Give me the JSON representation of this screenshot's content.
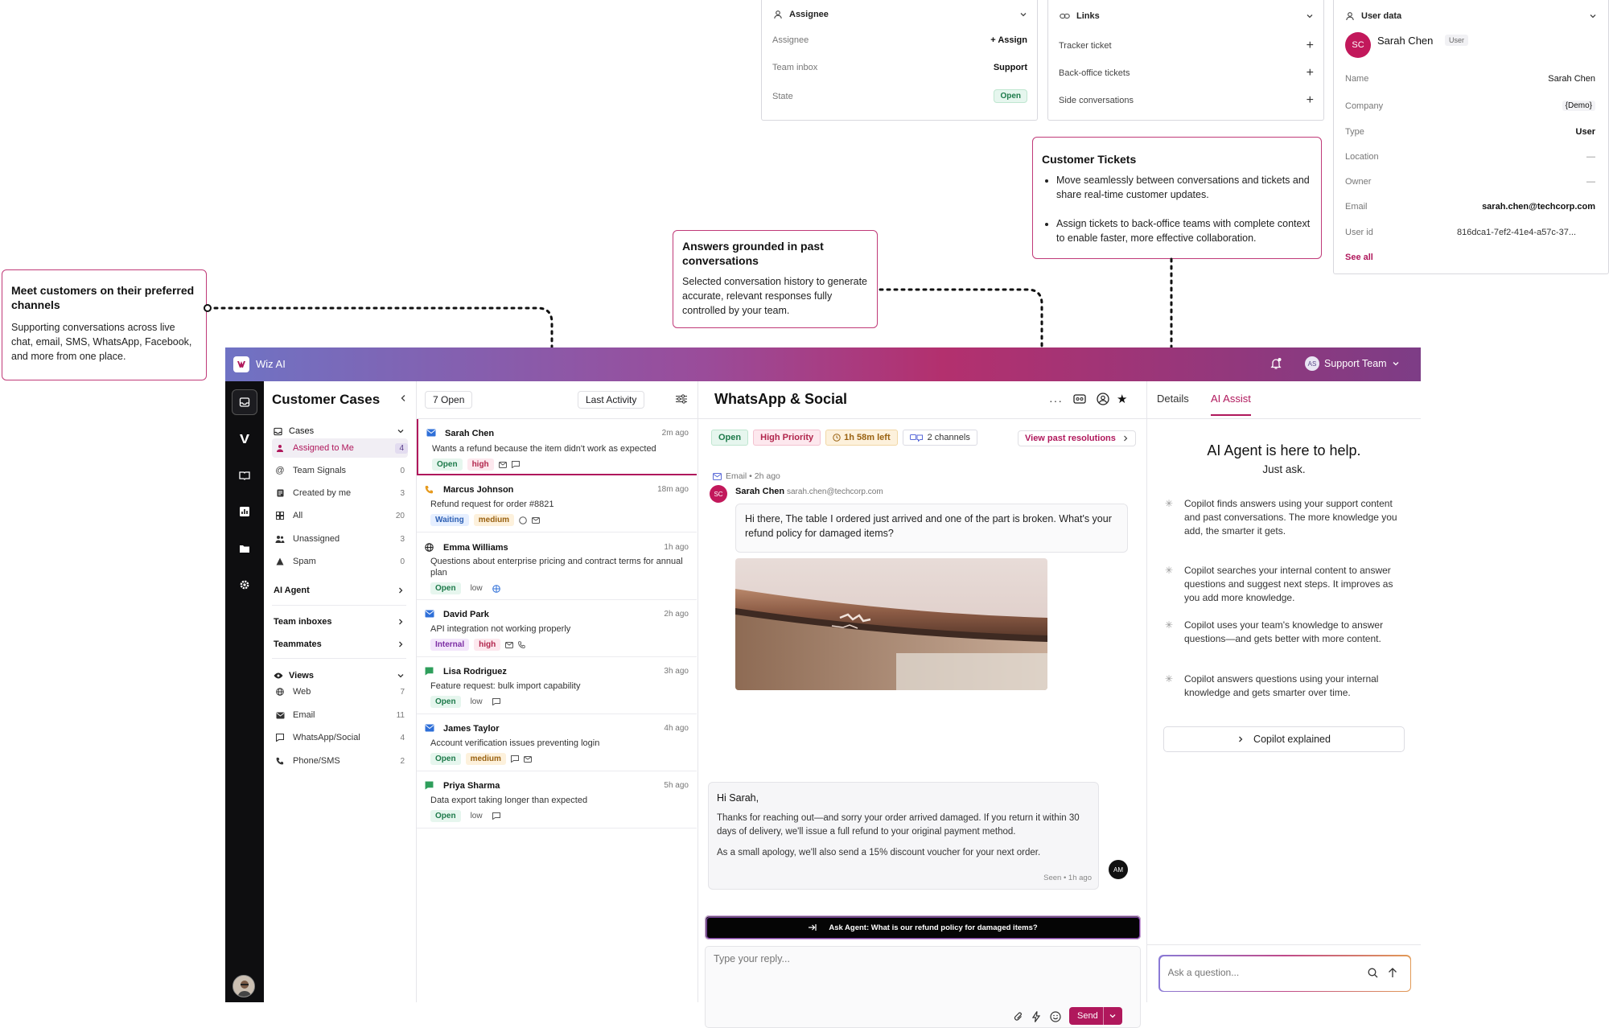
{
  "panels": {
    "assignee": {
      "title": "Assignee",
      "rows": [
        {
          "label": "Assignee",
          "value": "+ Assign"
        },
        {
          "label": "Team inbox",
          "value": "Support"
        },
        {
          "label": "State",
          "value": "Open"
        }
      ]
    },
    "links": {
      "title": "Links",
      "rows": [
        {
          "label": "Tracker ticket"
        },
        {
          "label": "Back-office tickets"
        },
        {
          "label": "Side conversations"
        }
      ]
    },
    "user_data": {
      "title": "User data",
      "avatar": "SC",
      "name": "Sarah Chen",
      "badge": "User",
      "rows": [
        {
          "label": "Name",
          "value": "Sarah Chen"
        },
        {
          "label": "Company",
          "value": "{Demo}"
        },
        {
          "label": "Type",
          "value": "User"
        },
        {
          "label": "Location",
          "value": "—"
        },
        {
          "label": "Owner",
          "value": "—"
        },
        {
          "label": "Email",
          "value": "sarah.chen@techcorp.com"
        },
        {
          "label": "User id",
          "value": "816dca1-7ef2-41e4-a57c-37..."
        }
      ],
      "see_all": "See all"
    }
  },
  "callouts": {
    "channels": {
      "title": "Meet customers on their preferred channels",
      "body": "Supporting conversations across live chat, email, SMS, WhatsApp, Facebook, and more from one place."
    },
    "answers": {
      "title": "Answers grounded in past conversations",
      "body": "Selected conversation history to generate accurate, relevant responses fully controlled by your team."
    },
    "tickets": {
      "title": "Customer Tickets",
      "bullets": [
        "Move seamlessly between conversations and tickets and share real-time customer updates.",
        "Assign tickets to back-office teams with complete context to enable faster, more effective collaboration."
      ]
    }
  },
  "app": {
    "brand": "Wiz AI",
    "team": {
      "initials": "AS",
      "label": "Support Team"
    },
    "nav": {
      "title": "Customer Cases",
      "cases_label": "Cases",
      "cases": [
        {
          "label": "Assigned to Me",
          "count": "4",
          "icon": "person-icon"
        },
        {
          "label": "Team Signals",
          "count": "0",
          "icon": "at-icon"
        },
        {
          "label": "Created by me",
          "count": "3",
          "icon": "doc-icon"
        },
        {
          "label": "All",
          "count": "20",
          "icon": "grid-icon"
        },
        {
          "label": "Unassigned",
          "count": "3",
          "icon": "people-icon"
        },
        {
          "label": "Spam",
          "count": "0",
          "icon": "warning-icon"
        }
      ],
      "ai_agent": "AI Agent",
      "team_inboxes": "Team inboxes",
      "teammates": "Teammates",
      "views_label": "Views",
      "views": [
        {
          "label": "Web",
          "count": "7",
          "icon": "globe-icon"
        },
        {
          "label": "Email",
          "count": "11",
          "icon": "mail-icon"
        },
        {
          "label": "WhatsApp/Social",
          "count": "4",
          "icon": "chat-icon"
        },
        {
          "label": "Phone/SMS",
          "count": "2",
          "icon": "phone-icon"
        }
      ]
    },
    "list": {
      "open_count": "7 Open",
      "sort": "Last Activity",
      "items": [
        {
          "name": "Sarah Chen",
          "time": "2m ago",
          "subject": "Wants a refund because the item didn't work as expected",
          "status": "Open",
          "priority": "high"
        },
        {
          "name": "Marcus Johnson",
          "time": "18m ago",
          "subject": "Refund request for order #8821",
          "status": "Waiting",
          "priority": "medium"
        },
        {
          "name": "Emma Williams",
          "time": "1h ago",
          "subject": "Questions about enterprise pricing and contract terms for annual plan",
          "status": "Open",
          "priority": "low"
        },
        {
          "name": "David Park",
          "time": "2h ago",
          "subject": "API integration not working properly",
          "status": "Internal",
          "priority": "high"
        },
        {
          "name": "Lisa Rodriguez",
          "time": "3h ago",
          "subject": "Feature request: bulk import capability",
          "status": "Open",
          "priority": "low"
        },
        {
          "name": "James Taylor",
          "time": "4h ago",
          "subject": "Account verification issues preventing login",
          "status": "Open",
          "priority": "medium"
        },
        {
          "name": "Priya Sharma",
          "time": "5h ago",
          "subject": "Data export taking longer than expected",
          "status": "Open",
          "priority": "low"
        }
      ]
    },
    "conversation": {
      "title": "WhatsApp & Social",
      "chips": {
        "status": "Open",
        "priority": "High Priority",
        "sla": "1h 58m left",
        "channels": "2 channels"
      },
      "past_resolutions": "View past resolutions",
      "meta": "Email • 2h ago",
      "sender": {
        "initials": "SC",
        "name": "Sarah Chen",
        "email": "sarah.chen@techcorp.com"
      },
      "customer_message": "Hi there, The table I ordered just arrived and one of the part is broken. What's your refund policy for damaged items?",
      "reply": {
        "greeting": "Hi Sarah,",
        "p1": "Thanks for reaching out—and sorry your order arrived damaged. If you return it within 30 days of delivery, we'll issue a full refund to your original payment method.",
        "p2": "As a small apology, we'll also send a 15% discount voucher for your next order.",
        "seen": "Seen • 1h ago",
        "avatar": "AM"
      },
      "ask_agent": "Ask Agent: What is our refund policy for damaged items?",
      "reply_placeholder": "Type your reply...",
      "send": "Send"
    },
    "side": {
      "tabs": [
        "Details",
        "AI Assist"
      ],
      "headline": "AI Agent is here to help.",
      "subline": "Just ask.",
      "points": [
        "Copilot finds answers using your support content and past conversations. The more knowledge you add, the smarter it gets.",
        "Copilot searches your internal content to answer questions and suggest next steps. It improves as you add more knowledge.",
        "Copilot uses your team's knowledge to answer questions—and gets better with more content.",
        "Copilot answers questions using your internal knowledge and gets smarter over time."
      ],
      "explained": "Copilot explained",
      "ask_placeholder": "Ask a question..."
    }
  },
  "colors": {
    "accent": "#b0185c",
    "open_green": "#1d7a4a",
    "high_red": "#b1254c"
  }
}
